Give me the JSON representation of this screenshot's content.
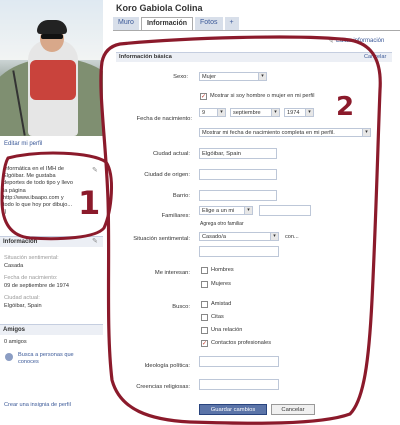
{
  "profile": {
    "name": "Koro Gabiola Colina",
    "edit_profile_label": "Editar mi perfil",
    "bio": "Informática en el IMH de Elgóibar. Me gustaba deportes de todo tipo y llevo la página http://www.ibaapo.com y todo lo que hoy por dibujo... ;)"
  },
  "tabs": [
    "Muro",
    "Información",
    "Fotos",
    "+"
  ],
  "left_info": {
    "heading": "Información",
    "items": [
      {
        "label": "Situación sentimental:",
        "value": "Casada"
      },
      {
        "label": "Fecha de nacimiento:",
        "value": "09 de septiembre de 1974"
      },
      {
        "label": "Ciudad actual:",
        "value": "Elgóibar, Spain"
      }
    ],
    "friends_heading": "Amigos",
    "friends_count": "0 amigos",
    "find_friends": "Busca a personas que conoces",
    "badge_link": "Crear una insignia de perfil"
  },
  "form": {
    "edit_info_label": "Editar información",
    "section_title": "Información básica",
    "cancel_label": "Cancelar",
    "sex_label": "Sexo:",
    "sex_value": "Mujer",
    "show_sex_label": "Mostrar si soy hombre o mujer en mi perfil",
    "birthdate_label": "Fecha de nacimiento:",
    "day": "9",
    "month": "septiembre",
    "year": "1974",
    "show_birthdate_value": "Mostrar mi fecha de nacimiento completa en mi perfil.",
    "city_label": "Ciudad actual:",
    "city_value": "Elgóibar, Spain",
    "hometown_label": "Ciudad de origen:",
    "hometown_value": "",
    "neighborhood_label": "Barrio:",
    "neighborhood_value": "",
    "family_label": "Familiares:",
    "family_select": "Elige a un mi",
    "family_input": "",
    "add_family": "Agrega otro familiar",
    "relationship_label": "Situación sentimental:",
    "relationship_value": "Casado/a",
    "relationship_with": "con...",
    "interested_label": "Me interesan:",
    "interested_options": [
      "Hombres",
      "Mujeres"
    ],
    "looking_label": "Busco:",
    "looking_options": [
      {
        "label": "Amistad",
        "checked": false
      },
      {
        "label": "Citas",
        "checked": false
      },
      {
        "label": "Una relación",
        "checked": false
      },
      {
        "label": "Contactos profesionales",
        "checked": true
      }
    ],
    "political_label": "Ideología política:",
    "religious_label": "Creencias religiosas:",
    "save_label": "Guardar cambios",
    "cancel_button_label": "Cancelar"
  },
  "annotations": {
    "one": "1",
    "two": "2",
    "color": "#8b1a2b"
  }
}
